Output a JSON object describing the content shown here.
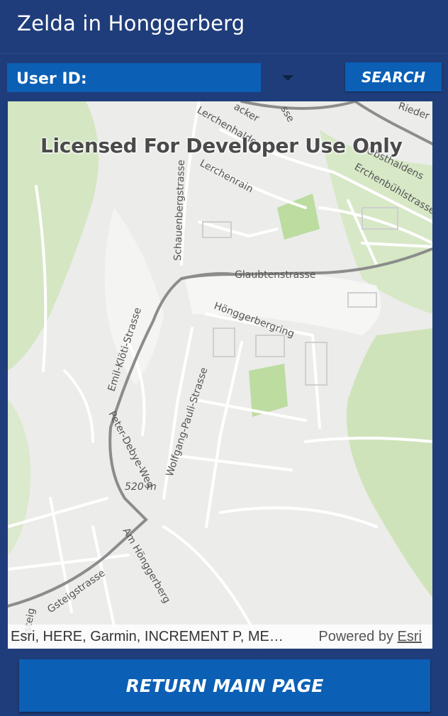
{
  "appbar": {
    "title": "Zelda in Honggerberg"
  },
  "user_id": {
    "label": "User ID:"
  },
  "dropdown": {
    "icon": "chevron-down-icon"
  },
  "search": {
    "label": "SEARCH"
  },
  "map": {
    "watermark": "Licensed For Developer Use Only",
    "labels": {
      "glaubtenstrasse": "Glaubtenstrasse",
      "honggerbergring": "Hönggerbergring",
      "emil_kloeti": "Emil-Klöti-Strasse",
      "peter_debye": "Peter-Debye-Weg",
      "wolfgang_pauli": "Wolfgang-Pauli-Strasse",
      "schauenbergstrasse": "Schauenbergstrasse",
      "lerchenrain": "Lerchenrain",
      "lerchenhalde": "Lerchenhalde",
      "obsthaldenstrasse": "Obsthaldens",
      "erchenbuehlstrasse": "Erchenbühlstrasse",
      "am_honggerberg": "Am Hönggerberg",
      "gsteigstrasse": "Gsteigstrasse",
      "gsteig": "Gsteig",
      "elevation": "520 m",
      "riedhof": "Rieder",
      "acker": "acker",
      "sse": "sse"
    },
    "attribution": "Esri, HERE, Garmin, INCREMENT P, METI/NASA, USGS",
    "powered_by": "Powered by",
    "esri": "Esri"
  },
  "footer": {
    "return_label": "RETURN MAIN PAGE"
  },
  "colors": {
    "app_bg": "#1f3d7a",
    "button": "#0b5fb5",
    "map_bg": "#ececea",
    "green_area": "#c8e0b0",
    "road": "#ffffff",
    "main_road": "#8c8c8c"
  }
}
